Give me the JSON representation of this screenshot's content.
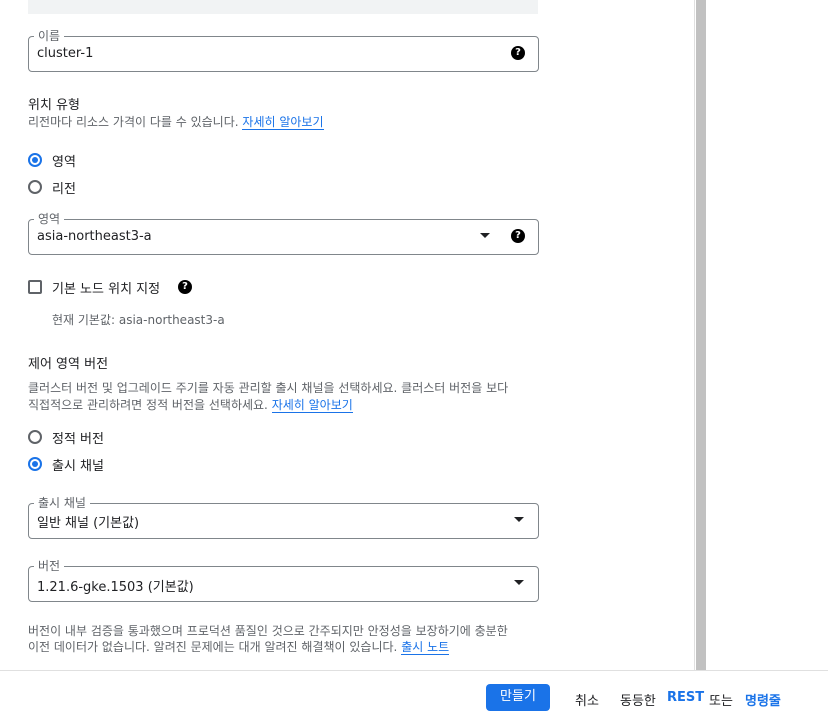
{
  "name_field": {
    "label": "이름",
    "value": "cluster-1"
  },
  "location_type": {
    "heading": "위치 유형",
    "desc": "리전마다 리소스 가격이 다를 수 있습니다.",
    "learn_more": "자세히 알아보기",
    "options": [
      {
        "label": "영역",
        "selected": true
      },
      {
        "label": "리전",
        "selected": false
      }
    ]
  },
  "zone_field": {
    "label": "영역",
    "value": "asia-northeast3-a"
  },
  "default_node_location": {
    "label": "기본 노드 위치 지정",
    "checked": false,
    "current_default": "현재 기본값: asia-northeast3-a"
  },
  "control_plane": {
    "heading": "제어 영역 버전",
    "desc_line1": "클러스터 버전 및 업그레이드 주기를 자동 관리할 출시 채널을 선택하세요. 클러스터 버전을 보다",
    "desc_line2": "직접적으로 관리하려면 정적 버전을 선택하세요.",
    "learn_more": "자세히 알아보기",
    "options": [
      {
        "label": "정적 버전",
        "selected": false
      },
      {
        "label": "출시 채널",
        "selected": true
      }
    ]
  },
  "release_channel_field": {
    "label": "출시 채널",
    "value": "일반 채널 (기본값)"
  },
  "version_field": {
    "label": "버전",
    "value": "1.21.6-gke.1503 (기본값)"
  },
  "version_note": {
    "line1": "버전이 내부 검증을 통과했으며 프로덕션 품질인 것으로 간주되지만 안정성을 보장하기에 충분한",
    "line2": "이전 데이터가 없습니다. 알려진 문제에는 대개 알려진 해결책이 있습니다.",
    "release_notes": "출시 노트"
  },
  "footer": {
    "create_label": "만들기",
    "cancel_label": "취소",
    "equivalent_label": "동등한",
    "rest_label": "REST",
    "or_label": "또는",
    "command_line_label": "명령줄"
  },
  "icons": {
    "help": "help-icon",
    "caret": "caret-down-icon"
  },
  "colors": {
    "accent": "#1a73e8"
  }
}
